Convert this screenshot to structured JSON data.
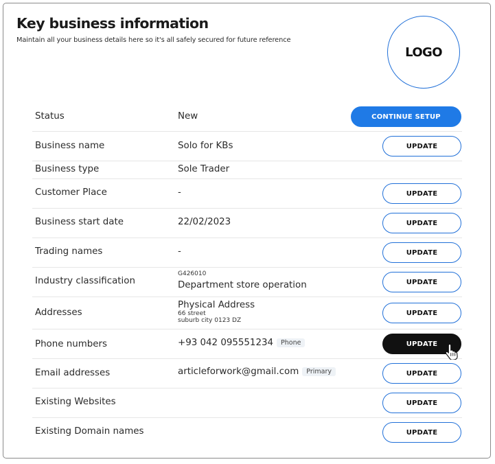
{
  "header": {
    "title": "Key business information",
    "subtitle": "Maintain all your business details here so it's all safely secured for future reference",
    "logo_text": "LOGO"
  },
  "rows": [
    {
      "label": "Status",
      "value": "New",
      "action": "CONTINUE SETUP"
    },
    {
      "label": "Business name",
      "value": "Solo for KBs",
      "action": "UPDATE"
    },
    {
      "label": "Business type",
      "value": "Sole Trader"
    },
    {
      "label": "Customer Place",
      "value": "-",
      "action": "UPDATE"
    },
    {
      "label": "Business start date",
      "value": "22/02/2023",
      "action": "UPDATE"
    },
    {
      "label": "Trading names",
      "value": "-",
      "action": "UPDATE"
    },
    {
      "label": "Industry classification",
      "code": "G426010",
      "value": "Department store operation",
      "action": "UPDATE"
    },
    {
      "label": "Addresses",
      "value": "Physical Address",
      "address_line1": "66 street",
      "address_line2": "suburb city 0123 DZ",
      "action": "UPDATE"
    },
    {
      "label": "Phone numbers",
      "value": "+93 042 095551234",
      "tag": "Phone",
      "action": "UPDATE"
    },
    {
      "label": "Email addresses",
      "value": "articleforwork@gmail.com",
      "tag": "Primary",
      "action": "UPDATE"
    },
    {
      "label": "Existing Websites",
      "value": "",
      "action": "UPDATE"
    },
    {
      "label": "Existing Domain names",
      "value": "",
      "action": "UPDATE"
    }
  ],
  "colors": {
    "accent": "#1f7ae6",
    "dark_button": "#111111"
  },
  "icons": {
    "cursor": "hand-pointer-icon"
  }
}
